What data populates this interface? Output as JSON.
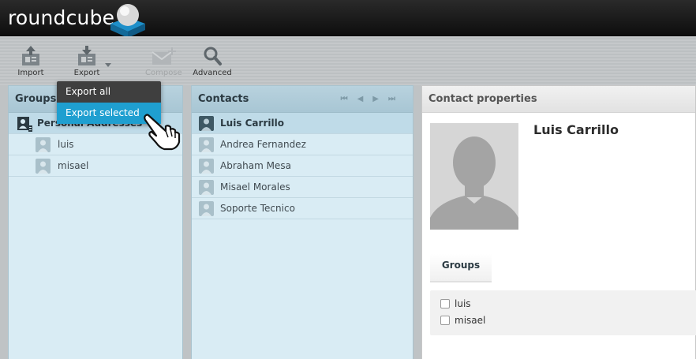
{
  "header": {
    "logo_text": "roundcube"
  },
  "toolbar": {
    "import_label": "Import",
    "export_label": "Export",
    "compose_label": "Compose",
    "advanced_label": "Advanced"
  },
  "export_menu": {
    "items": [
      {
        "label": "Export all"
      },
      {
        "label": "Export selected"
      }
    ]
  },
  "groups_panel": {
    "title": "Groups",
    "items": [
      {
        "label": "Personal Addresses"
      },
      {
        "label": "luis"
      },
      {
        "label": "misael"
      }
    ]
  },
  "contacts_panel": {
    "title": "Contacts",
    "items": [
      {
        "label": "Luis Carrillo"
      },
      {
        "label": "Andrea Fernandez"
      },
      {
        "label": "Abraham Mesa"
      },
      {
        "label": "Misael Morales"
      },
      {
        "label": "Soporte Tecnico"
      }
    ]
  },
  "contact_properties": {
    "title": "Contact properties",
    "name": "Luis Carrillo",
    "groups_tab": "Groups",
    "groups": [
      {
        "label": "luis",
        "checked": false
      },
      {
        "label": "misael",
        "checked": false
      }
    ]
  },
  "colors": {
    "accent": "#1f9fd0",
    "panel_bg": "#d9ecf4",
    "panel_header": "#b8d2de",
    "header_bg": "#111111"
  }
}
